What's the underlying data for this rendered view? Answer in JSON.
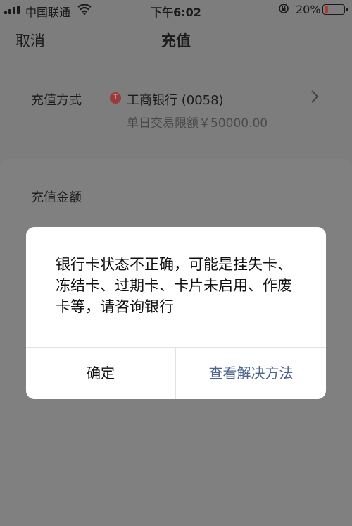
{
  "status_bar": {
    "carrier": "中国联通",
    "time": "下午6:02",
    "battery_percent": "20%",
    "battery_level": 0.2,
    "battery_color": "#b23a2e"
  },
  "nav": {
    "cancel_label": "取消",
    "title": "充值"
  },
  "payment": {
    "method_label": "充值方式",
    "bank_icon": "工",
    "bank_name": "工商银行 (0058)",
    "daily_limit": "单日交易限额￥50000.00"
  },
  "amount": {
    "label": "充值金额"
  },
  "dialog": {
    "message": "银行卡状态不正确，可能是挂失卡、冻结卡、过期卡、卡片未启用、作废卡等，请咨询银行",
    "confirm_label": "确定",
    "solution_label": "查看解决方法",
    "accent_color": "#4b6490"
  }
}
